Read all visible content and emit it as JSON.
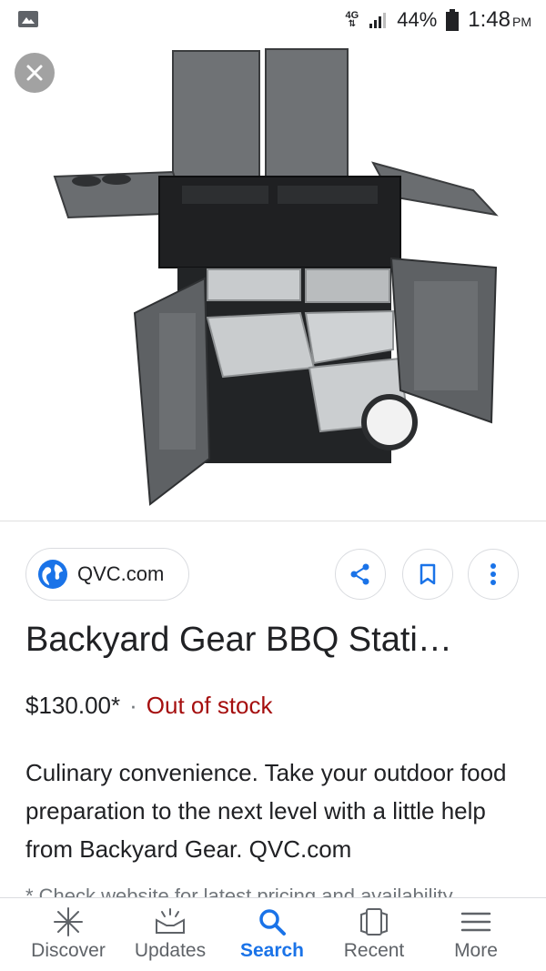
{
  "status_bar": {
    "network": "4G",
    "battery": "44%",
    "time": "1:48",
    "ampm": "PM"
  },
  "source": {
    "label": "QVC.com"
  },
  "product": {
    "title": "Backyard Gear BBQ Stati…",
    "price": "$130.00*",
    "separator": "·",
    "stock": "Out of stock",
    "description": "Culinary convenience. Take your outdoor food preparation to the next level with a little help from Backyard Gear. QVC.com",
    "disclaimer": "* Check website for latest pricing and availability."
  },
  "nav": {
    "items": [
      {
        "label": "Discover",
        "icon": "asterisk-icon"
      },
      {
        "label": "Updates",
        "icon": "updates-icon"
      },
      {
        "label": "Search",
        "icon": "search-icon"
      },
      {
        "label": "Recent",
        "icon": "recent-icon"
      },
      {
        "label": "More",
        "icon": "menu-icon"
      }
    ],
    "active": "Search"
  },
  "colors": {
    "accent": "#1a73e8",
    "stock_red": "#a50e0e",
    "text": "#202124",
    "muted": "#5f6368"
  }
}
